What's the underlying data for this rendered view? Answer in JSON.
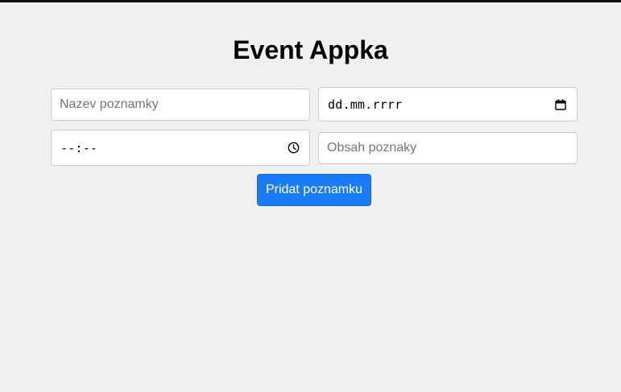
{
  "header": {
    "title": "Event Appka"
  },
  "form": {
    "name_placeholder": "Nazev poznamky",
    "date_value": "dd.mm.rrrr",
    "date_icon": "calendar-icon",
    "time_value": "--:--",
    "time_icon": "clock-icon",
    "content_placeholder": "Obsah poznaky",
    "submit_label": "Pridat poznamku"
  },
  "colors": {
    "background": "#f0f0f0",
    "accent": "#1a7cf5",
    "top_bar": "#111111"
  }
}
